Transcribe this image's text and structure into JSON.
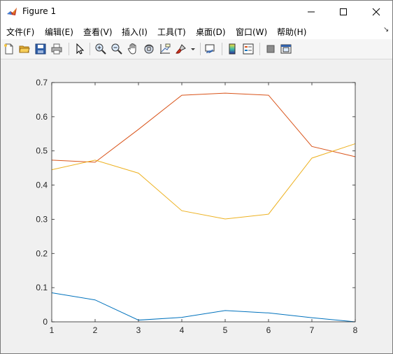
{
  "window": {
    "title": "Figure 1"
  },
  "menu": {
    "items": [
      "文件(F)",
      "编辑(E)",
      "查看(V)",
      "插入(I)",
      "工具(T)",
      "桌面(D)",
      "窗口(W)",
      "帮助(H)"
    ]
  },
  "toolbar": {
    "icons": [
      "new-figure-icon",
      "open-file-icon",
      "save-icon",
      "print-icon",
      "pointer-icon",
      "zoom-in-icon",
      "zoom-out-icon",
      "pan-icon",
      "rotate-3d-icon",
      "data-cursor-icon",
      "brush-icon",
      "brush-dropdown-icon",
      "link-plot-icon",
      "colorbar-icon",
      "legend-icon",
      "hide-plot-tools-icon",
      "show-plot-tools-icon"
    ]
  },
  "chart_data": {
    "type": "line",
    "x": [
      1,
      2,
      3,
      4,
      5,
      6,
      7,
      8
    ],
    "xlim": [
      1,
      8
    ],
    "ylim": [
      0,
      0.7
    ],
    "xticks": [
      "1",
      "2",
      "3",
      "4",
      "5",
      "6",
      "7",
      "8"
    ],
    "yticks": [
      "0",
      "0.1",
      "0.2",
      "0.3",
      "0.4",
      "0.5",
      "0.6",
      "0.7"
    ],
    "grid": false,
    "series": [
      {
        "color": "#0072bd",
        "values": [
          0.085,
          0.064,
          0.005,
          0.013,
          0.033,
          0.026,
          0.012,
          0.0
        ]
      },
      {
        "color": "#d95319",
        "values": [
          0.473,
          0.467,
          0.563,
          0.663,
          0.669,
          0.663,
          0.513,
          0.483
        ]
      },
      {
        "color": "#edb120",
        "values": [
          0.445,
          0.473,
          0.435,
          0.325,
          0.301,
          0.315,
          0.479,
          0.521
        ]
      }
    ]
  }
}
